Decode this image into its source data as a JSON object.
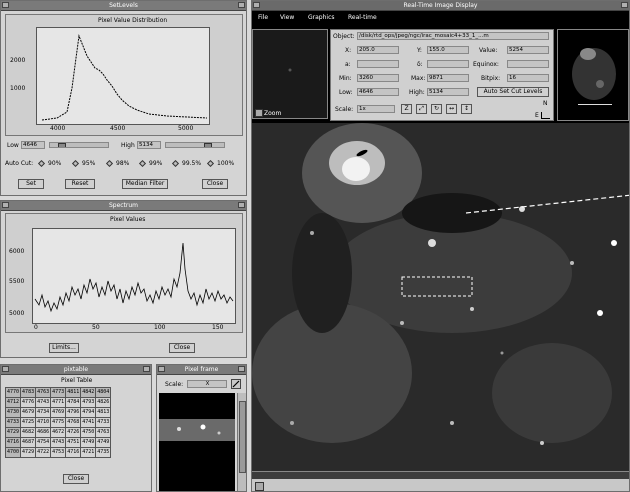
{
  "colors": {
    "titlebar": "#7a7a7a",
    "panel": "#d4d4d4",
    "accent": "#000000"
  },
  "setlevels": {
    "title": "SetLevels",
    "chart_title": "Pixel Value Distribution",
    "ytick_top": "2000",
    "ytick_mid": "1000",
    "xticks": [
      "4000",
      "4500",
      "5000"
    ],
    "low_label": "Low",
    "low_value": "4646",
    "high_label": "High",
    "high_value": "5134",
    "autocut_label": "Auto Cut:",
    "autocut_options": [
      "90%",
      "95%",
      "98%",
      "99%",
      "99.5%",
      "100%"
    ],
    "buttons": {
      "set": "Set",
      "reset": "Reset",
      "median": "Median Filter",
      "close": "Close"
    }
  },
  "spectrum": {
    "title": "Spectrum",
    "chart_title": "Pixel Values",
    "yticks": [
      "6000",
      "5500",
      "5000"
    ],
    "xticks": [
      "0",
      "50",
      "100",
      "150"
    ],
    "buttons": {
      "limits": "Limits...",
      "close": "Close"
    }
  },
  "pixtable": {
    "title": "pixtable",
    "heading": "Pixel Table",
    "rows": [
      [
        "4770",
        "4783",
        "4763",
        "4773",
        "4811",
        "4842",
        "4804"
      ],
      [
        "4712",
        "4776",
        "4743",
        "4771",
        "4784",
        "4793",
        "4826"
      ],
      [
        "4730",
        "4679",
        "4734",
        "4769",
        "4796",
        "4794",
        "4813"
      ],
      [
        "4733",
        "4725",
        "4710",
        "4775",
        "4768",
        "4741",
        "4733"
      ],
      [
        "4729",
        "4682",
        "4686",
        "4672",
        "4726",
        "4750",
        "4763"
      ],
      [
        "4716",
        "4687",
        "4754",
        "4743",
        "4751",
        "4749",
        "4749"
      ],
      [
        "4700",
        "4729",
        "4722",
        "4753",
        "4716",
        "4721",
        "4735"
      ]
    ],
    "close": "Close"
  },
  "pixelframe": {
    "title": "Pixel frame",
    "scale_label": "Scale:",
    "scale_value": "X"
  },
  "main": {
    "title": "Real-Time Image Display",
    "menu": [
      "File",
      "View",
      "Graphics",
      "Real-time"
    ],
    "object_label": "Object:",
    "object_value": "/disk/rtd_ops/jpeg/ngc/irac_mosaic4+33_1_...m",
    "x_label": "X:",
    "x_value": "205.0",
    "y_label": "Y:",
    "y_value": "155.0",
    "value_label": "Value:",
    "value_value": "5254",
    "a_label": "a:",
    "a_value": "",
    "d_label": "δ:",
    "d_value": "",
    "equinox_label": "Equinox:",
    "equinox_value": "",
    "min_label": "Min:",
    "min_value": "3260",
    "max_label": "Max:",
    "max_value": "9871",
    "bitpix_label": "Bitpix:",
    "bitpix_value": "16",
    "low_label": "Low:",
    "low_value": "4646",
    "high_label": "High:",
    "high_value": "5134",
    "autoset_label": "Auto Set Cut Levels",
    "scale_label": "Scale:",
    "scale_value": "1x",
    "zoom_label": "Zoom",
    "compass_n": "N",
    "compass_e": "E"
  }
}
